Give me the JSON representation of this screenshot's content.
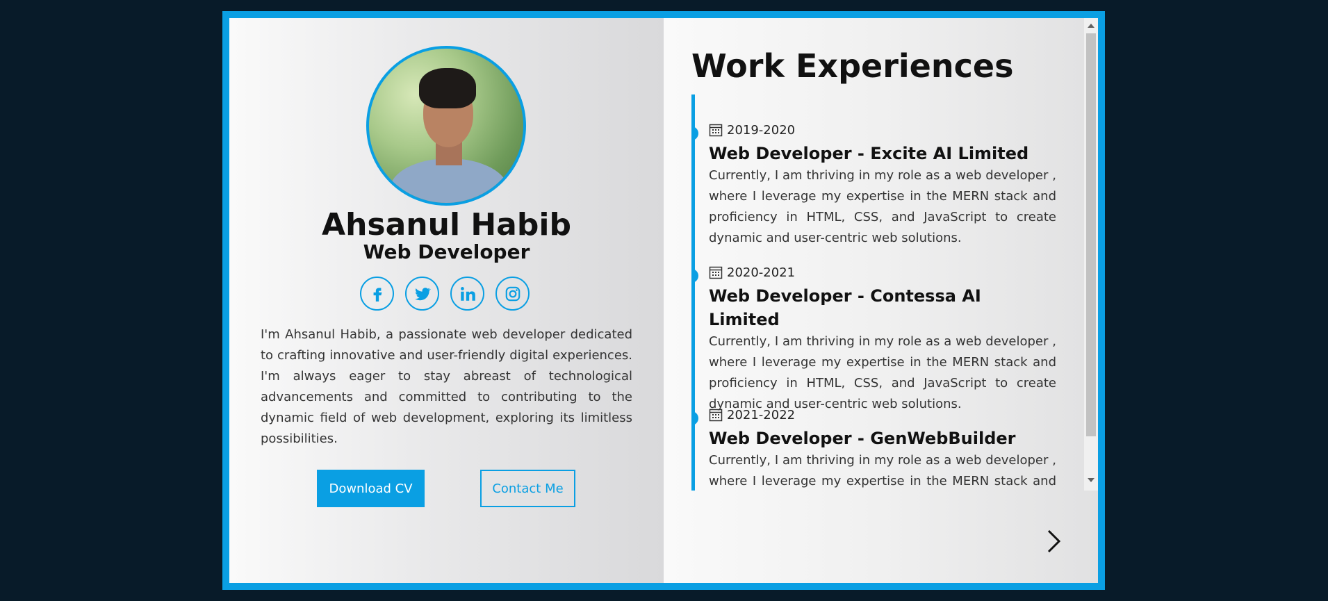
{
  "profile": {
    "name": "Ahsanul Habib",
    "role": "Web Developer",
    "bio": "I'm Ahsanul Habib, a passionate web developer dedicated to crafting innovative and user-friendly digital experiences. I'm always eager to stay abreast of technological advancements and committed to contributing to the dynamic field of web development, exploring its limitless possibilities.",
    "socials": [
      "facebook-icon",
      "twitter-icon",
      "linkedin-icon",
      "instagram-icon"
    ],
    "download_label": "Download CV",
    "contact_label": "Contact Me"
  },
  "work": {
    "title": "Work Experiences",
    "items": [
      {
        "date": "2019-2020",
        "job": "Web Developer - Excite AI Limited",
        "desc": "Currently, I am thriving in my role as a web developer , where I leverage my expertise in the MERN stack and proficiency in HTML, CSS, and JavaScript to create dynamic and user-centric web solutions."
      },
      {
        "date": "2020-2021",
        "job": "Web Developer - Contessa AI Limited",
        "desc": "Currently, I am thriving in my role as a web developer , where I leverage my expertise in the MERN stack and proficiency in HTML, CSS, and JavaScript to create dynamic and user-centric web solutions."
      },
      {
        "date": "2021-2022",
        "job": "Web Developer - GenWebBuilder",
        "desc": "Currently, I am thriving in my role as a web developer , where I leverage my expertise in the MERN stack and proficiency in HTML, CSS, and JavaScript to create dynamic and user-centric web solutions."
      }
    ]
  },
  "colors": {
    "accent": "#0a9fe3",
    "background": "#081b29"
  }
}
